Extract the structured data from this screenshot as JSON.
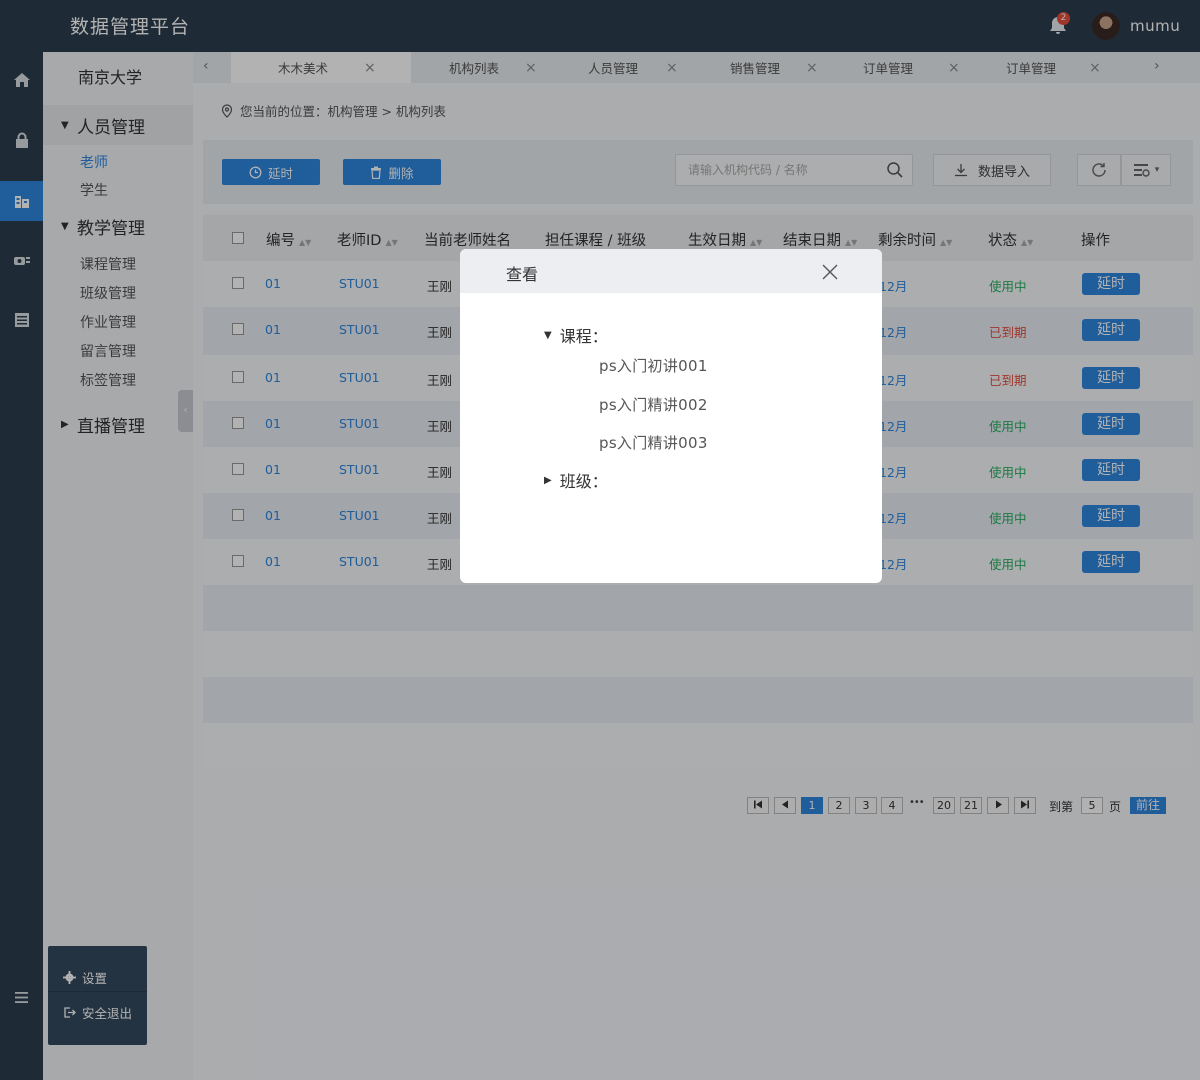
{
  "app": {
    "title": "数据管理平台",
    "user": "mumu",
    "notification_count": "2"
  },
  "sidebar": {
    "org": "南京大学",
    "groups": [
      {
        "label": "人员管理",
        "arrow": "▼",
        "items": [
          "老师",
          "学生"
        ]
      },
      {
        "label": "教学管理",
        "arrow": "▼",
        "items": [
          "课程管理",
          "班级管理",
          "作业管理",
          "留言管理",
          "标签管理"
        ]
      },
      {
        "label": "直播管理",
        "arrow": "▶",
        "items": []
      }
    ],
    "collapse_glyph": "‹"
  },
  "tabs": {
    "prev": "‹",
    "next": "›",
    "close": "×",
    "items": [
      "木木美术",
      "机构列表",
      "人员管理",
      "销售管理",
      "订单管理",
      "订单管理"
    ]
  },
  "breadcrumb": {
    "text": "您当前的位置：机构管理 > 机构列表"
  },
  "toolbar": {
    "extend_label": "延时",
    "delete_label": "删除",
    "search_placeholder": "请输入机构代码 / 名称",
    "import_label": "数据导入",
    "caret": "▾"
  },
  "table": {
    "columns": [
      "编号",
      "老师ID",
      "当前老师姓名",
      "担任课程 / 班级",
      "生效日期",
      "结束日期",
      "剩余时间",
      "状态",
      "操作"
    ],
    "sort_glyph": "▲▼",
    "rows": [
      {
        "no": "01",
        "tid": "STU01",
        "name": "王刚",
        "remain": "12月",
        "status": "使用中",
        "status_color": "#27ae60",
        "op": "延时"
      },
      {
        "no": "01",
        "tid": "STU01",
        "name": "王刚",
        "remain": "12月",
        "status": "已到期",
        "status_color": "#e74c3c",
        "op": "延时"
      },
      {
        "no": "01",
        "tid": "STU01",
        "name": "王刚",
        "remain": "12月",
        "status": "已到期",
        "status_color": "#e74c3c",
        "op": "延时"
      },
      {
        "no": "01",
        "tid": "STU01",
        "name": "王刚",
        "remain": "12月",
        "status": "使用中",
        "status_color": "#27ae60",
        "op": "延时"
      },
      {
        "no": "01",
        "tid": "STU01",
        "name": "王刚",
        "remain": "12月",
        "status": "使用中",
        "status_color": "#27ae60",
        "op": "延时"
      },
      {
        "no": "01",
        "tid": "STU01",
        "name": "王刚",
        "remain": "12月",
        "status": "使用中",
        "status_color": "#27ae60",
        "op": "延时"
      },
      {
        "no": "01",
        "tid": "STU01",
        "name": "王刚",
        "remain": "12月",
        "status": "使用中",
        "status_color": "#27ae60",
        "op": "延时"
      }
    ]
  },
  "pager": {
    "pages": [
      "1",
      "2",
      "3",
      "4",
      "20",
      "21"
    ],
    "ellipsis": "•••",
    "current": "1",
    "first": "⏮",
    "prev": "◀",
    "next": "▶",
    "last": "⏭",
    "goto_label": "到第",
    "goto_value": "5",
    "page_unit": "页",
    "go_button": "前往"
  },
  "bottom_menu": {
    "settings": "设置",
    "logout": "安全退出"
  },
  "modal": {
    "title": "查看",
    "course_label": "课程：",
    "courses": [
      "ps入门初讲001",
      "ps入门精讲002",
      "ps入门精讲003"
    ],
    "class_label": "班级：",
    "expand_glyph": "▼",
    "collapse_glyph": "▶"
  },
  "colors": {
    "primary": "#2e86de",
    "sidebar_dark": "#2c3e50",
    "success": "#27ae60",
    "danger": "#e74c3c"
  }
}
